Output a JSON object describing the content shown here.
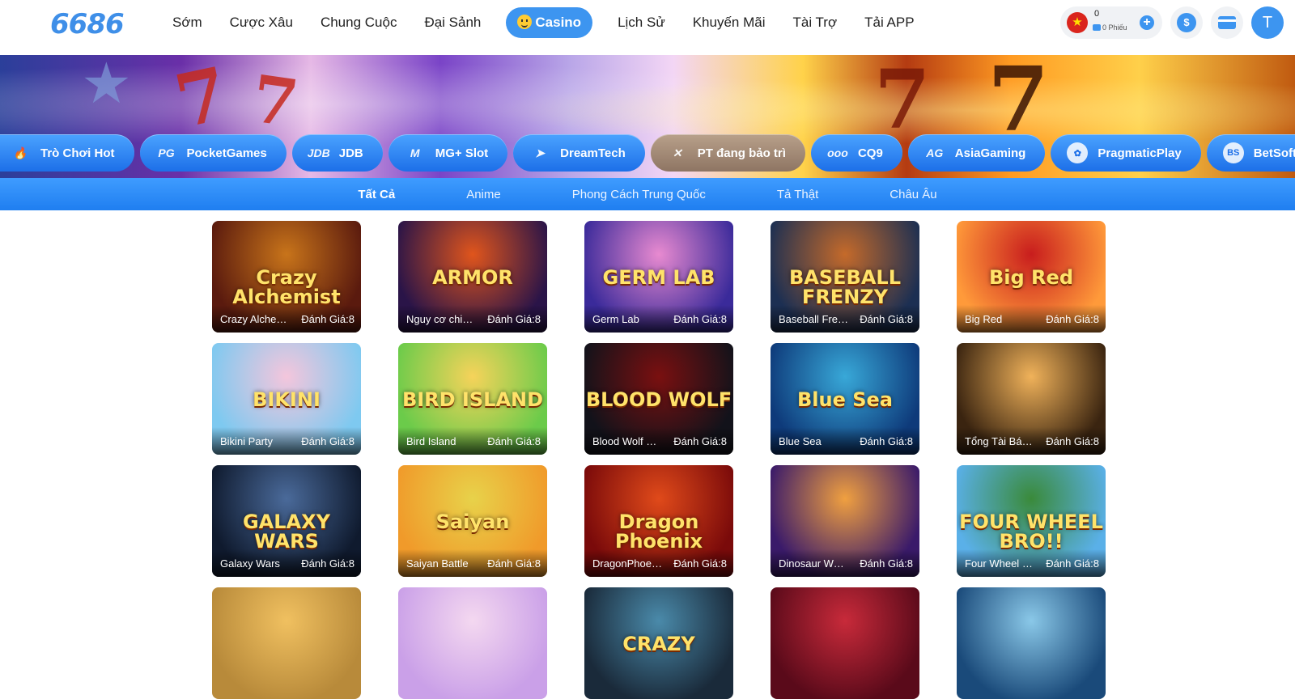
{
  "header": {
    "logo": "6686",
    "nav": [
      {
        "label": "Sớm",
        "active": false
      },
      {
        "label": "Cược Xâu",
        "active": false
      },
      {
        "label": "Chung Cuộc",
        "active": false
      },
      {
        "label": "Đại Sảnh",
        "active": false
      },
      {
        "label": "Casino",
        "active": true
      },
      {
        "label": "Lịch Sử",
        "active": false
      },
      {
        "label": "Khuyến Mãi",
        "active": false
      },
      {
        "label": "Tài Trợ",
        "active": false
      },
      {
        "label": "Tải APP",
        "active": false
      }
    ],
    "wallet": {
      "balance": "0",
      "tickets": "0 Phiếu",
      "flag_glyph": "★"
    },
    "deposit_glyph": "$",
    "avatar_letter": "T",
    "accent": "#3d95f0"
  },
  "providers": [
    {
      "label": "Trò Chơi Hot",
      "icon": "flame-icon",
      "glyph": "🔥",
      "maintenance": false
    },
    {
      "label": "PocketGames",
      "icon": "pg-logo-icon",
      "glyph": "PG",
      "maintenance": false
    },
    {
      "label": "JDB",
      "icon": "jdb-logo-icon",
      "glyph": "JDB",
      "maintenance": false
    },
    {
      "label": "MG+ Slot",
      "icon": "mg-logo-icon",
      "glyph": "M",
      "maintenance": false
    },
    {
      "label": "DreamTech",
      "icon": "dreamtech-logo-icon",
      "glyph": "➤",
      "maintenance": false
    },
    {
      "label": "PT đang bảo trì",
      "icon": "pt-logo-icon",
      "glyph": "✕",
      "maintenance": true
    },
    {
      "label": "CQ9",
      "icon": "cq9-logo-icon",
      "glyph": "ooo",
      "maintenance": false
    },
    {
      "label": "AsiaGaming",
      "icon": "ag-logo-icon",
      "glyph": "AG",
      "maintenance": false
    },
    {
      "label": "PragmaticPlay",
      "icon": "pragmatic-logo-icon",
      "glyph": "✿",
      "maintenance": false
    },
    {
      "label": "BetSoft",
      "icon": "betsoft-logo-icon",
      "glyph": "BS",
      "maintenance": false
    }
  ],
  "tabs": [
    {
      "label": "Tất Cả",
      "active": true
    },
    {
      "label": "Anime",
      "active": false
    },
    {
      "label": "Phong Cách Trung Quốc",
      "active": false
    },
    {
      "label": "Tả Thật",
      "active": false
    },
    {
      "label": "Châu Âu",
      "active": false
    }
  ],
  "games": [
    {
      "name": "Crazy Alchemist",
      "rating": "Đánh Giá:8",
      "title_art": "Crazy Alchemist",
      "c1": "#5a1a0e",
      "c2": "#c8741a"
    },
    {
      "name": "Nguy cơ chiến giáp",
      "rating": "Đánh Giá:8",
      "title_art": "ARMOR",
      "c1": "#2a1448",
      "c2": "#e0551c"
    },
    {
      "name": "Germ Lab",
      "rating": "Đánh Giá:8",
      "title_art": "GERM LAB",
      "c1": "#3a2a9a",
      "c2": "#e88ad0"
    },
    {
      "name": "Baseball Frenzy",
      "rating": "Đánh Giá:8",
      "title_art": "BASEBALL FRENZY",
      "c1": "#1c2f52",
      "c2": "#c56a2a"
    },
    {
      "name": "Big Red",
      "rating": "Đánh Giá:8",
      "title_art": "Big Red",
      "c1": "#ff9a3a",
      "c2": "#c81d1d"
    },
    {
      "name": "Bikini Party",
      "rating": "Đánh Giá:8",
      "title_art": "BIKINI",
      "c1": "#7ec9f0",
      "c2": "#f4c6dc"
    },
    {
      "name": "Bird Island",
      "rating": "Đánh Giá:8",
      "title_art": "BIRD ISLAND",
      "c1": "#6bcb4a",
      "c2": "#f6d35a"
    },
    {
      "name": "Blood Wolf Legend",
      "rating": "Đánh Giá:8",
      "title_art": "BLOOD WOLF",
      "c1": "#12121a",
      "c2": "#7a1010"
    },
    {
      "name": "Blue Sea",
      "rating": "Đánh Giá:8",
      "title_art": "Blue Sea",
      "c1": "#0e3a7a",
      "c2": "#38a8d8"
    },
    {
      "name": "Tổng Tài Bá Đạo",
      "rating": "Đánh Giá:8",
      "title_art": "",
      "c1": "#3a2410",
      "c2": "#f0b25a"
    },
    {
      "name": "Galaxy Wars",
      "rating": "Đánh Giá:8",
      "title_art": "GALAXY WARS",
      "c1": "#0f1a2e",
      "c2": "#4a6a9a"
    },
    {
      "name": "Saiyan Battle",
      "rating": "Đánh Giá:8",
      "title_art": "Saiyan",
      "c1": "#f09a2a",
      "c2": "#e8d24a"
    },
    {
      "name": "DragonPhoenixProsper",
      "rating": "Đánh Giá:8",
      "title_art": "Dragon Phoenix",
      "c1": "#7a0a0a",
      "c2": "#e04a1a"
    },
    {
      "name": "Dinosaur World",
      "rating": "Đánh Giá:8",
      "title_art": "",
      "c1": "#3a1a6a",
      "c2": "#f0a040"
    },
    {
      "name": "Four Wheel Bro",
      "rating": "Đánh Giá:8",
      "title_art": "FOUR WHEEL BRO!!",
      "c1": "#5ab0e8",
      "c2": "#3a8a3a"
    },
    {
      "name": "",
      "rating": "",
      "title_art": "",
      "c1": "#b88a3a",
      "c2": "#f0c060"
    },
    {
      "name": "",
      "rating": "",
      "title_art": "",
      "c1": "#caa0e8",
      "c2": "#f4d8f0"
    },
    {
      "name": "",
      "rating": "",
      "title_art": "CRAZY",
      "c1": "#1a2a3a",
      "c2": "#4a8aaa"
    },
    {
      "name": "",
      "rating": "",
      "title_art": "",
      "c1": "#5a0a1a",
      "c2": "#c82a3a"
    },
    {
      "name": "",
      "rating": "",
      "title_art": "",
      "c1": "#1a4a7a",
      "c2": "#8ac8e8"
    }
  ]
}
